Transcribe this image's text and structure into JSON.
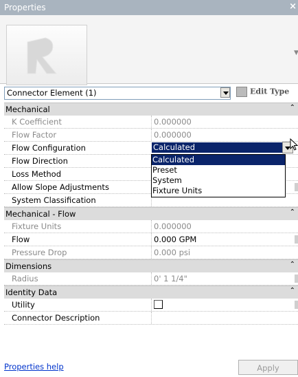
{
  "window": {
    "title": "Properties"
  },
  "type_selector": {
    "value": "Connector Element (1)",
    "edit_type_label": "Edit Type"
  },
  "categories": [
    {
      "label": "Mechanical",
      "rows": [
        {
          "name": "K Coefficient",
          "value": "0.000000"
        },
        {
          "name": "Flow Factor",
          "value": "0.000000"
        },
        {
          "name": "Flow Configuration",
          "value": "Calculated"
        },
        {
          "name": "Flow Direction",
          "value": ""
        },
        {
          "name": "Loss Method",
          "value": ""
        },
        {
          "name": "Allow Slope Adjustments",
          "value": ""
        },
        {
          "name": "System Classification",
          "value": ""
        }
      ]
    },
    {
      "label": "Mechanical - Flow",
      "rows": [
        {
          "name": "Fixture Units",
          "value": "0.000000"
        },
        {
          "name": "Flow",
          "value": "0.000 GPM"
        },
        {
          "name": "Pressure Drop",
          "value": "0.000 psi"
        }
      ]
    },
    {
      "label": "Dimensions",
      "rows": [
        {
          "name": "Radius",
          "value": "0'  1 1/4\""
        }
      ]
    },
    {
      "label": "Identity Data",
      "rows": [
        {
          "name": "Utility",
          "value": ""
        },
        {
          "name": "Connector Description",
          "value": ""
        }
      ]
    }
  ],
  "dropdown_options": [
    "Calculated",
    "Preset",
    "System",
    "Fixture Units"
  ],
  "footer": {
    "help_label": "Properties help",
    "apply_label": "Apply"
  }
}
